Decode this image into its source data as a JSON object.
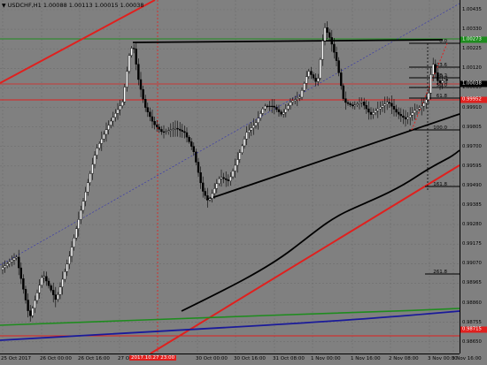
{
  "window": {
    "title": "USDCHF,H1  1.00088 1.00113 1.00015 1.00038",
    "symbol": "USDCHF",
    "timeframe": "H1",
    "ohlc": {
      "open": "1.00088",
      "high": "1.00113",
      "low": "1.00015",
      "close": "1.00038"
    }
  },
  "price_axis": {
    "labels": [
      "1.00435",
      "1.00330",
      "1.00225",
      "1.00120",
      "1.00015",
      "0.99910",
      "0.99805",
      "0.99700",
      "0.99595",
      "0.99490",
      "0.99385",
      "0.99280",
      "0.99175",
      "0.99070",
      "0.98965",
      "0.98860",
      "0.98755",
      "0.98650"
    ],
    "tags": [
      {
        "value": "1.00273",
        "bg": "#1e8c1e",
        "fg": "#ffffff"
      },
      {
        "value": "1.00038",
        "bg": "#000000",
        "fg": "#ffffff"
      },
      {
        "value": "0.99952",
        "bg": "#e0201e",
        "fg": "#ffffff"
      },
      {
        "value": "0.98715",
        "bg": "#e0201e",
        "fg": "#ffffff"
      }
    ]
  },
  "time_axis": {
    "labels": [
      "25 Oct 2017",
      "26 Oct 00:00",
      "26 Oct 16:00",
      "27 Oct 08:00",
      "30 Oct 00:00",
      "30 Oct 16:00",
      "31 Oct 08:00",
      "1 Nov 00:00",
      "1 Nov 16:00",
      "2 Nov 08:00",
      "3 Nov 00:00",
      "3 Nov 16:00"
    ],
    "highlight": "2017.10.27 23:00"
  },
  "fibonacci": {
    "levels": [
      "0.0",
      "23.6",
      "38.2",
      "50.0",
      "61.8",
      "100.0",
      "161.8",
      "261.8"
    ]
  },
  "colors": {
    "background": "#808080",
    "bull_candle": "#ffffff",
    "bear_candle": "#000000",
    "resistance_line": "#1e8c1e",
    "support_red": "#e0201e",
    "ma_black": "#000000",
    "ma_green": "#1e8c1e",
    "ma_blue": "#1a1a9a",
    "channel_blue_dotted": "#3a3aaa"
  }
}
